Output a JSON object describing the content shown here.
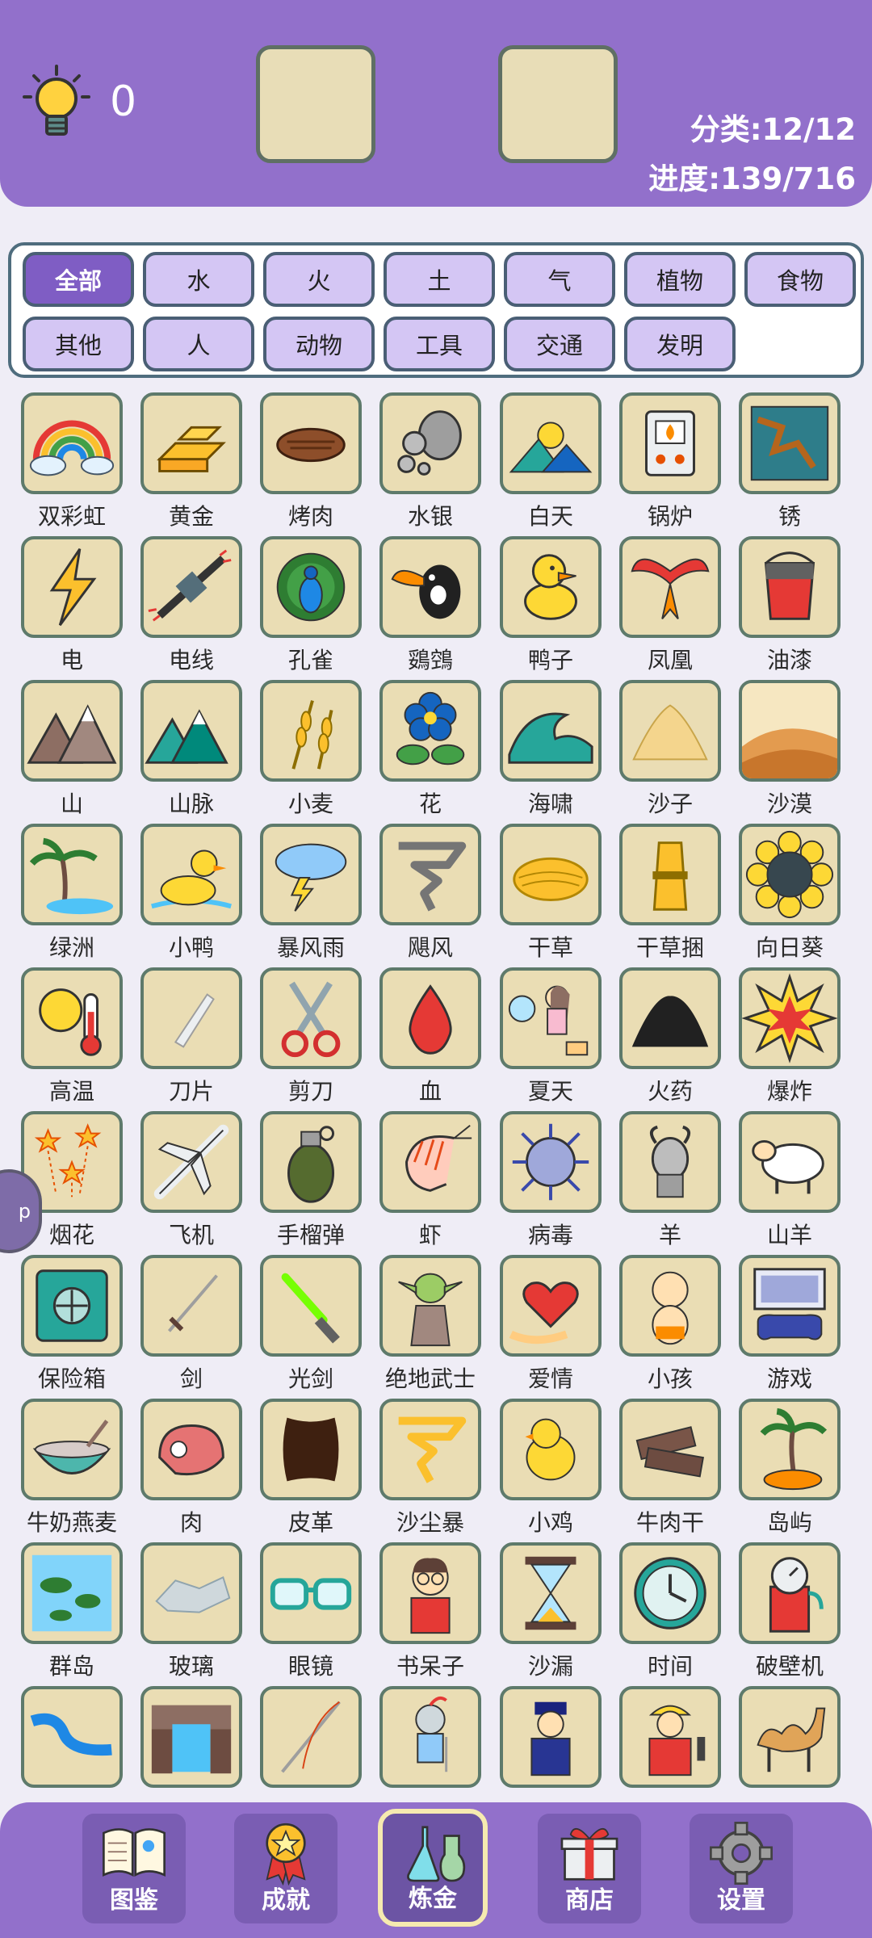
{
  "header": {
    "hint_count": "0",
    "category_progress": "分类:12/12",
    "overall_progress": "进度:139/716"
  },
  "filters": {
    "row1": [
      "全部",
      "水",
      "火",
      "土",
      "气",
      "植物",
      "食物"
    ],
    "row2": [
      "其他",
      "人",
      "动物",
      "工具",
      "交通",
      "发明"
    ],
    "active": "全部"
  },
  "items": [
    {
      "name": "双彩虹",
      "icon": "double-rainbow-icon"
    },
    {
      "name": "黄金",
      "icon": "gold-icon"
    },
    {
      "name": "烤肉",
      "icon": "roast-meat-icon"
    },
    {
      "name": "水银",
      "icon": "mercury-icon"
    },
    {
      "name": "白天",
      "icon": "daytime-icon"
    },
    {
      "name": "锅炉",
      "icon": "boiler-icon"
    },
    {
      "name": "锈",
      "icon": "rust-icon"
    },
    {
      "name": "电",
      "icon": "electricity-icon"
    },
    {
      "name": "电线",
      "icon": "wire-icon"
    },
    {
      "name": "孔雀",
      "icon": "peacock-icon"
    },
    {
      "name": "鵎鵼",
      "icon": "toucan-icon"
    },
    {
      "name": "鸭子",
      "icon": "duck-icon"
    },
    {
      "name": "凤凰",
      "icon": "phoenix-icon"
    },
    {
      "name": "油漆",
      "icon": "paint-icon"
    },
    {
      "name": "山",
      "icon": "mountain-icon"
    },
    {
      "name": "山脉",
      "icon": "mountain-range-icon"
    },
    {
      "name": "小麦",
      "icon": "wheat-icon"
    },
    {
      "name": "花",
      "icon": "flower-icon"
    },
    {
      "name": "海啸",
      "icon": "tsunami-icon"
    },
    {
      "name": "沙子",
      "icon": "sand-icon"
    },
    {
      "name": "沙漠",
      "icon": "desert-icon"
    },
    {
      "name": "绿洲",
      "icon": "oasis-icon"
    },
    {
      "name": "小鸭",
      "icon": "duckling-icon"
    },
    {
      "name": "暴风雨",
      "icon": "storm-icon"
    },
    {
      "name": "飓风",
      "icon": "hurricane-icon"
    },
    {
      "name": "干草",
      "icon": "hay-icon"
    },
    {
      "name": "干草捆",
      "icon": "haystack-icon"
    },
    {
      "name": "向日葵",
      "icon": "sunflower-icon"
    },
    {
      "name": "高温",
      "icon": "heat-icon"
    },
    {
      "name": "刀片",
      "icon": "blade-icon"
    },
    {
      "name": "剪刀",
      "icon": "scissors-icon"
    },
    {
      "name": "血",
      "icon": "blood-icon"
    },
    {
      "name": "夏天",
      "icon": "summer-icon"
    },
    {
      "name": "火药",
      "icon": "gunpowder-icon"
    },
    {
      "name": "爆炸",
      "icon": "explosion-icon"
    },
    {
      "name": "烟花",
      "icon": "fireworks-icon"
    },
    {
      "name": "飞机",
      "icon": "airplane-icon"
    },
    {
      "name": "手榴弹",
      "icon": "grenade-icon"
    },
    {
      "name": "虾",
      "icon": "shrimp-icon"
    },
    {
      "name": "病毒",
      "icon": "virus-icon"
    },
    {
      "name": "羊",
      "icon": "goat-icon"
    },
    {
      "name": "山羊",
      "icon": "sheep-icon"
    },
    {
      "name": "保险箱",
      "icon": "safe-icon"
    },
    {
      "name": "剑",
      "icon": "sword-icon"
    },
    {
      "name": "光剑",
      "icon": "lightsaber-icon"
    },
    {
      "name": "绝地武士",
      "icon": "jedi-icon"
    },
    {
      "name": "爱情",
      "icon": "love-icon"
    },
    {
      "name": "小孩",
      "icon": "baby-icon"
    },
    {
      "name": "游戏",
      "icon": "game-icon"
    },
    {
      "name": "牛奶燕麦",
      "icon": "oatmeal-icon"
    },
    {
      "name": "肉",
      "icon": "meat-icon"
    },
    {
      "name": "皮革",
      "icon": "leather-icon"
    },
    {
      "name": "沙尘暴",
      "icon": "sandstorm-icon"
    },
    {
      "name": "小鸡",
      "icon": "chick-icon"
    },
    {
      "name": "牛肉干",
      "icon": "jerky-icon"
    },
    {
      "name": "岛屿",
      "icon": "island-icon"
    },
    {
      "name": "群岛",
      "icon": "archipelago-icon"
    },
    {
      "name": "玻璃",
      "icon": "glass-icon"
    },
    {
      "name": "眼镜",
      "icon": "glasses-icon"
    },
    {
      "name": "书呆子",
      "icon": "nerd-icon"
    },
    {
      "name": "沙漏",
      "icon": "hourglass-icon"
    },
    {
      "name": "时间",
      "icon": "clock-icon"
    },
    {
      "name": "破壁机",
      "icon": "blender-icon"
    },
    {
      "name": "",
      "icon": "river-icon"
    },
    {
      "name": "",
      "icon": "waterfall-icon"
    },
    {
      "name": "",
      "icon": "needle-icon"
    },
    {
      "name": "",
      "icon": "knight-icon"
    },
    {
      "name": "",
      "icon": "police-icon"
    },
    {
      "name": "",
      "icon": "electrician-icon"
    },
    {
      "name": "",
      "icon": "camel-icon"
    }
  ],
  "side_tab": {
    "label": "p"
  },
  "nav": [
    {
      "label": "图鉴",
      "icon": "book-icon"
    },
    {
      "label": "成就",
      "icon": "medal-icon"
    },
    {
      "label": "炼金",
      "icon": "flask-icon"
    },
    {
      "label": "商店",
      "icon": "gift-icon"
    },
    {
      "label": "设置",
      "icon": "gear-icon"
    }
  ],
  "nav_active": "炼金",
  "colors": {
    "header_purple": "#9270CB",
    "card_bg": "#EADDB4",
    "filter_active": "#7F5DC4",
    "filter_inactive": "#D4C6F4"
  }
}
